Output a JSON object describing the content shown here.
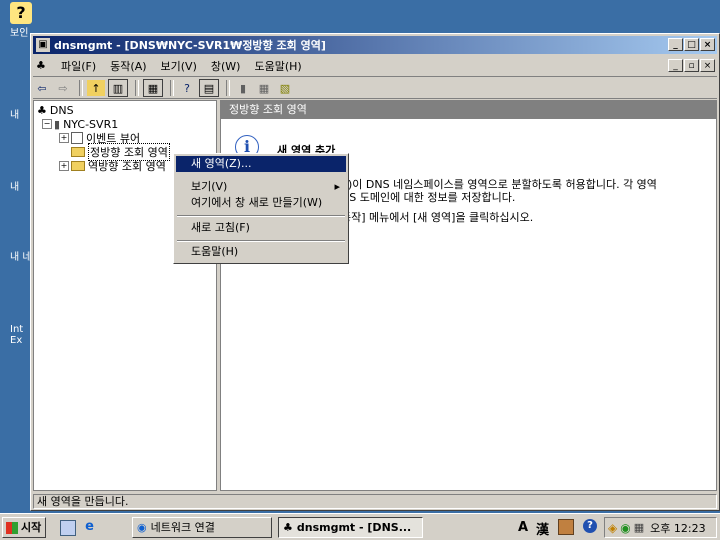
{
  "desktop": {
    "icons": [
      {
        "label": "보인",
        "name": "my-documents"
      },
      {
        "label": "내",
        "name": "my-computer"
      },
      {
        "label": "내",
        "name": "my-network"
      },
      {
        "label": "내 네",
        "name": "network-places"
      },
      {
        "label": "Int",
        "name": "internet-explorer"
      },
      {
        "label": "Ex",
        "name": "internet-explorer-2"
      }
    ]
  },
  "window": {
    "title": "dnsmgmt - [DNS₩NYC-SVR1₩정방향 조회 영역]",
    "menu": [
      "파일(F)",
      "동작(A)",
      "보기(V)",
      "창(W)",
      "도움말(H)"
    ]
  },
  "tree": {
    "root": "DNS",
    "server": "NYC-SVR1",
    "children": [
      "이벤트 뷰어",
      "정방향 조회 영역",
      "역방향 조회 영역"
    ]
  },
  "right_pane": {
    "header": "정방향 조회 영역",
    "info_title": "새 영역 추가",
    "line1": "S)이 DNS 네임스페이스를 영역으로 분할하도록 허용합니다. 각 영역",
    "line2": "NS 도메인에 대한 정보를 저장합니다.",
    "line3": "동작] 메뉴에서 [새 영역]을 클릭하십시오."
  },
  "context_menu": {
    "items": [
      "새 영역(Z)...",
      "보기(V)",
      "여기에서 창 새로 만들기(W)",
      "새로 고침(F)",
      "도움말(H)"
    ],
    "submenu_arrow": "▸"
  },
  "status": "새 영역을 만듭니다.",
  "taskbar": {
    "start": "시작",
    "buttons": [
      "네트워크 연결",
      "dnsmgmt - [DNS..."
    ],
    "ime": [
      "A",
      "漢"
    ],
    "clock": "오후 12:23"
  }
}
